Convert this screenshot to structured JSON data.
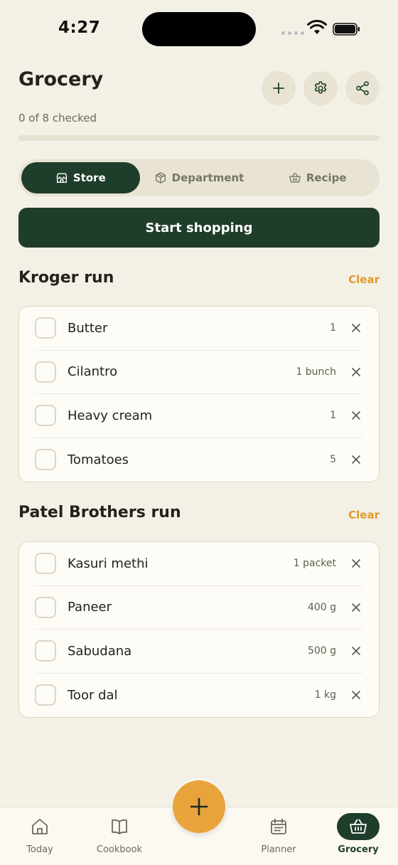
{
  "status_bar": {
    "time": "4:27"
  },
  "header": {
    "title": "Grocery",
    "progress_text": "0 of 8 checked",
    "progress_fraction": 0,
    "actions": [
      "plus-icon",
      "gear-icon",
      "share-icon"
    ]
  },
  "tabs": [
    {
      "label": "Store",
      "icon": "store-icon",
      "active": true
    },
    {
      "label": "Department",
      "icon": "box-icon",
      "active": false
    },
    {
      "label": "Recipe",
      "icon": "basket-icon",
      "active": false
    }
  ],
  "start_button": "Start shopping",
  "sections": [
    {
      "title": "Kroger run",
      "clear_label": "Clear",
      "items": [
        {
          "name": "Butter",
          "qty": "1"
        },
        {
          "name": "Cilantro",
          "qty": "1 bunch"
        },
        {
          "name": "Heavy cream",
          "qty": "1"
        },
        {
          "name": "Tomatoes",
          "qty": "5"
        }
      ]
    },
    {
      "title": "Patel Brothers run",
      "clear_label": "Clear",
      "items": [
        {
          "name": "Kasuri methi",
          "qty": "1 packet"
        },
        {
          "name": "Paneer",
          "qty": "400 g"
        },
        {
          "name": "Sabudana",
          "qty": "500 g"
        },
        {
          "name": "Toor dal",
          "qty": "1 kg"
        }
      ]
    }
  ],
  "nav": {
    "items": [
      {
        "label": "Today",
        "icon": "home-icon",
        "active": false
      },
      {
        "label": "Cookbook",
        "icon": "book-icon",
        "active": false
      },
      {
        "label": "Planner",
        "icon": "calendar-icon",
        "active": false
      },
      {
        "label": "Grocery",
        "icon": "basket-icon",
        "active": true
      }
    ],
    "fab_icon": "plus-icon"
  },
  "colors": {
    "background": "#f3f0e6",
    "primary": "#1f3d2b",
    "accent": "#e8a33a",
    "clear_link": "#e29a2b"
  }
}
